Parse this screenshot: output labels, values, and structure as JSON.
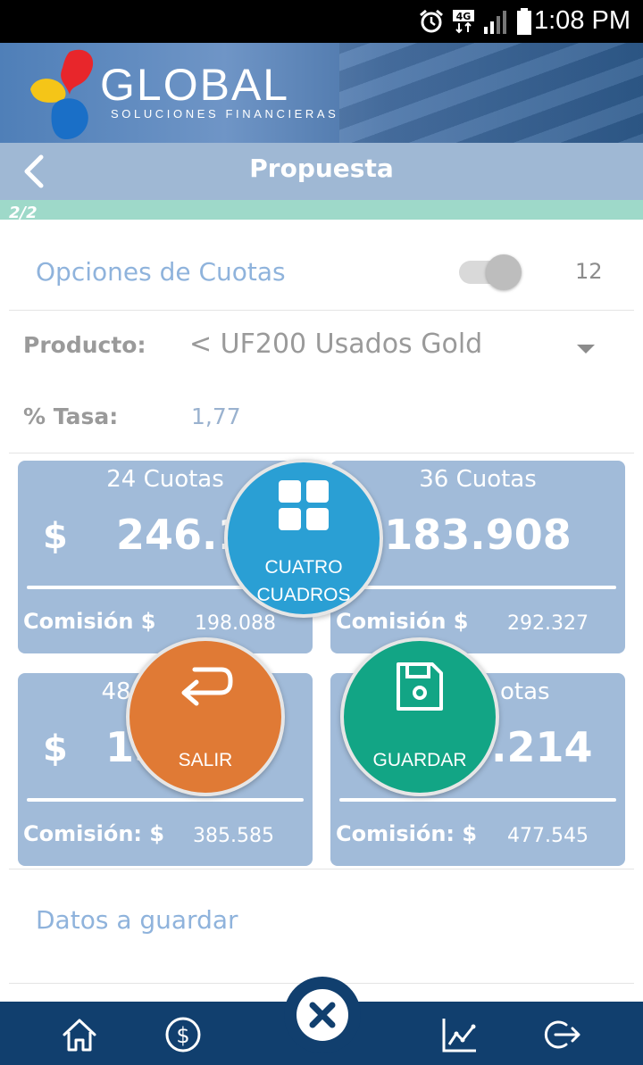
{
  "status_bar": {
    "time": "1:08 PM",
    "network": "4G"
  },
  "banner": {
    "brand": "GLOBAL",
    "tagline": "SOLUCIONES FINANCIERAS"
  },
  "header": {
    "title": "Propuesta",
    "step": "2/2"
  },
  "options": {
    "label": "Opciones de Cuotas",
    "toggle_on": true,
    "count": "12"
  },
  "product": {
    "label": "Producto:",
    "value": "< UF200 Usados Gold"
  },
  "rate": {
    "label": "% Tasa:",
    "value": "1,77"
  },
  "plans": [
    {
      "title": "24 Cuotas",
      "currency": "$",
      "amount": "246.17",
      "commission_label": "Comisión $",
      "commission": "198.088"
    },
    {
      "title": "36 Cuotas",
      "currency": "",
      "amount": "183.908",
      "commission_label": "Comisión $",
      "commission": "292.327"
    },
    {
      "title": "48",
      "currency": "$",
      "amount": "15",
      "commission_label": "Comisión: $",
      "commission": "385.585"
    },
    {
      "title": "otas",
      "currency": "",
      "amount": ".214",
      "commission_label": "Comisión: $",
      "commission": "477.545"
    }
  ],
  "actions": {
    "cuatro": {
      "line1": "CUATRO",
      "line2": "CUADROS",
      "icon": "grid-icon",
      "color": "#2a9fd4"
    },
    "salir": {
      "label": "SALIR",
      "icon": "return-arrow-icon",
      "color": "#e07a35"
    },
    "guardar": {
      "label": "GUARDAR",
      "icon": "save-disk-icon",
      "color": "#12a585"
    }
  },
  "datos": {
    "label": "Datos a guardar"
  },
  "bottom_nav": {
    "items": [
      "home-icon",
      "dollar-icon",
      "close-icon",
      "chart-icon",
      "logout-icon"
    ],
    "color": "#113f6e"
  }
}
